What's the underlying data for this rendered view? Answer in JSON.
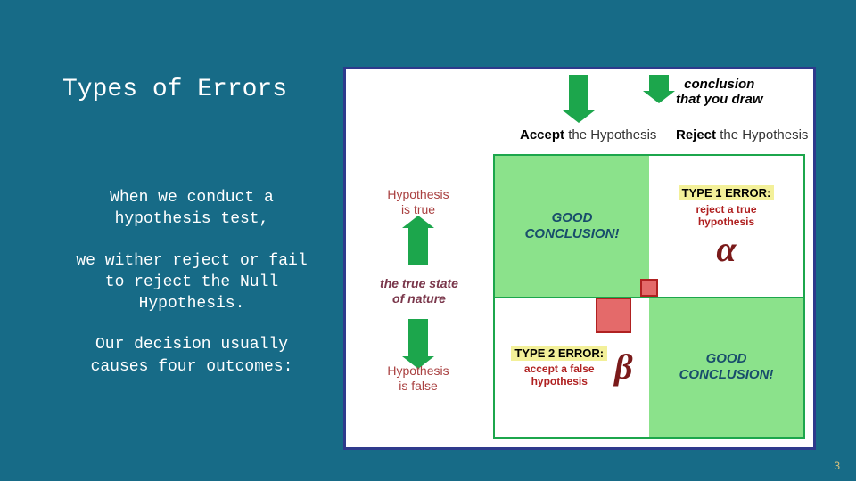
{
  "title": "Types of Errors",
  "paragraphs": {
    "p1": "When we conduct a hypothesis test,",
    "p2": "we wither reject or fail to reject the Null Hypothesis.",
    "p3": "Our decision usually causes four outcomes:"
  },
  "diagram": {
    "conclusion_label_l1": "conclusion",
    "conclusion_label_l2": "that you draw",
    "col1_prefix": "Accept",
    "col1_rest": " the Hypothesis",
    "col2_prefix": "Reject",
    "col2_rest": " the Hypothesis",
    "row1_l1": "Hypothesis",
    "row1_l2": "is true",
    "row2_l1": "Hypothesis",
    "row2_l2": "is false",
    "state_l1": "the true state",
    "state_l2": "of nature",
    "good_l1": "GOOD",
    "good_l2": "CONCLUSION!",
    "type1_title": "TYPE 1 ERROR:",
    "type1_desc_l1": "reject a true",
    "type1_desc_l2": "hypothesis",
    "alpha": "α",
    "type2_title": "TYPE 2 ERROR:",
    "type2_desc_l1": "accept a false",
    "type2_desc_l2": "hypothesis",
    "beta": "β"
  },
  "page_number": "3"
}
